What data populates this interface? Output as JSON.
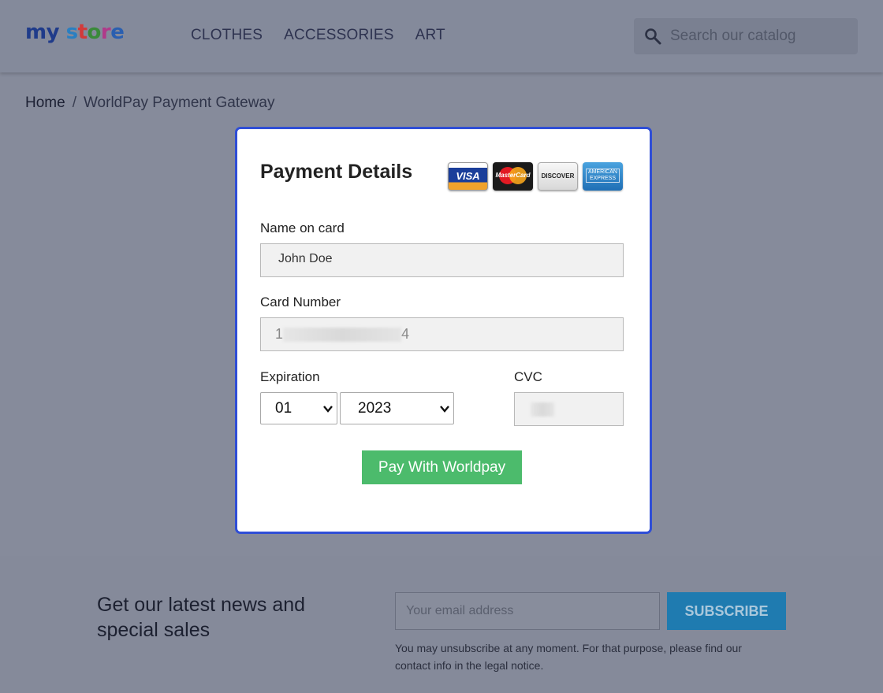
{
  "header": {
    "logo": {
      "text": "my store",
      "parts": [
        "m",
        "y",
        " ",
        "s",
        "t",
        "o",
        "r",
        "e"
      ]
    },
    "nav": [
      "CLOTHES",
      "ACCESSORIES",
      "ART"
    ],
    "search": {
      "placeholder": "Search our catalog",
      "icon": "search-icon"
    }
  },
  "breadcrumb": {
    "home": "Home",
    "separator": "/",
    "current": "WorldPay Payment Gateway"
  },
  "payment": {
    "title": "Payment Details",
    "cards": [
      {
        "name": "VISA",
        "icon": "visa-card-icon"
      },
      {
        "name": "MasterCard",
        "icon": "mastercard-icon"
      },
      {
        "name": "DISCOVER",
        "icon": "discover-card-icon"
      },
      {
        "name": "AMERICAN EXPRESS",
        "icon": "amex-card-icon"
      }
    ],
    "name_label": "Name on card",
    "name_value": "John Doe",
    "card_label": "Card Number",
    "card_prefix": "1",
    "card_suffix": "4",
    "expiration_label": "Expiration",
    "month": "01",
    "year": "2023",
    "cvc_label": "CVC",
    "pay_button": "Pay With Worldpay"
  },
  "newsletter": {
    "title": "Get our latest news and special sales",
    "email_placeholder": "Your email address",
    "subscribe": "SUBSCRIBE",
    "note": "You may unsubscribe at any moment. For that purpose, please find our contact info in the legal notice."
  },
  "colors": {
    "modal_border": "#2f4ed6",
    "pay_button": "#4cbb6c",
    "subscribe_button": "#1f7bb0",
    "overlay": "#868b9b"
  }
}
